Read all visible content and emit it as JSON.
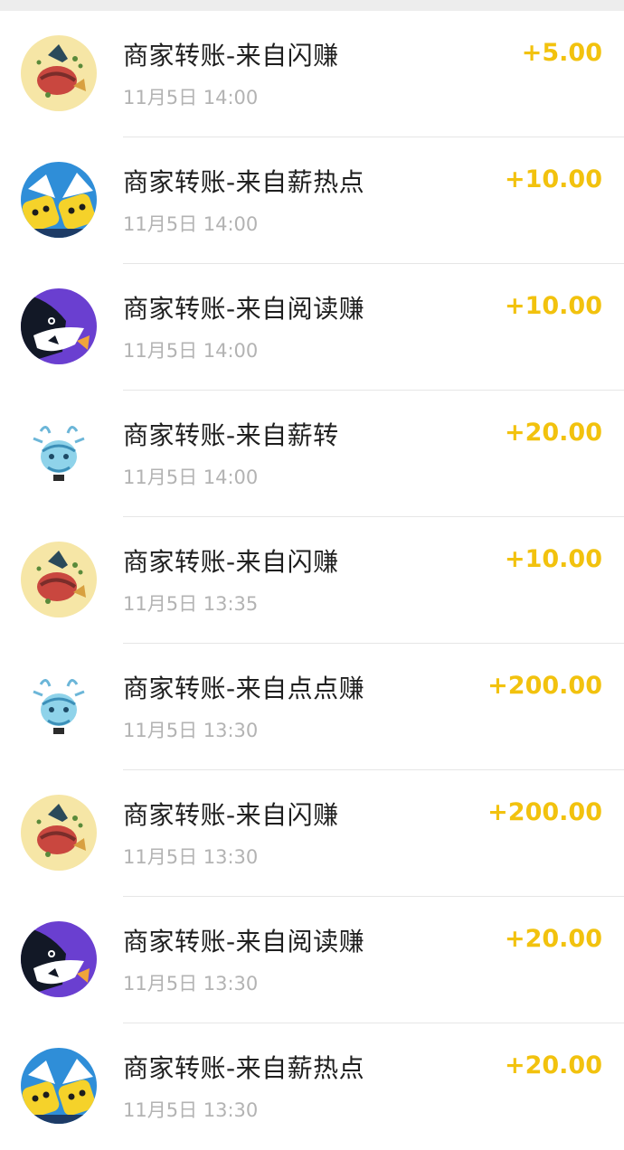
{
  "colors": {
    "amount": "#f2c20e",
    "title": "#1f1f1f",
    "time": "#b3b3b3",
    "divider": "#e6e6e6"
  },
  "transactions": [
    {
      "title": "商家转账-来自闪赚",
      "time": "11月5日 14:00",
      "amount": "+5.00",
      "icon": "shanzhuan-app-icon"
    },
    {
      "title": "商家转账-来自薪热点",
      "time": "11月5日 14:00",
      "amount": "+10.00",
      "icon": "xinredian-app-icon"
    },
    {
      "title": "商家转账-来自阅读赚",
      "time": "11月5日 14:00",
      "amount": "+10.00",
      "icon": "yueduzhuan-app-icon"
    },
    {
      "title": "商家转账-来自薪转",
      "time": "11月5日 14:00",
      "amount": "+20.00",
      "icon": "xinzhuan-app-icon"
    },
    {
      "title": "商家转账-来自闪赚",
      "time": "11月5日 13:35",
      "amount": "+10.00",
      "icon": "shanzhuan-app-icon"
    },
    {
      "title": "商家转账-来自点点赚",
      "time": "11月5日 13:30",
      "amount": "+200.00",
      "icon": "diandianzhuan-app-icon"
    },
    {
      "title": "商家转账-来自闪赚",
      "time": "11月5日 13:30",
      "amount": "+200.00",
      "icon": "shanzhuan-app-icon"
    },
    {
      "title": "商家转账-来自阅读赚",
      "time": "11月5日 13:30",
      "amount": "+20.00",
      "icon": "yueduzhuan-app-icon"
    },
    {
      "title": "商家转账-来自薪热点",
      "time": "11月5日 13:30",
      "amount": "+20.00",
      "icon": "xinredian-app-icon"
    }
  ]
}
